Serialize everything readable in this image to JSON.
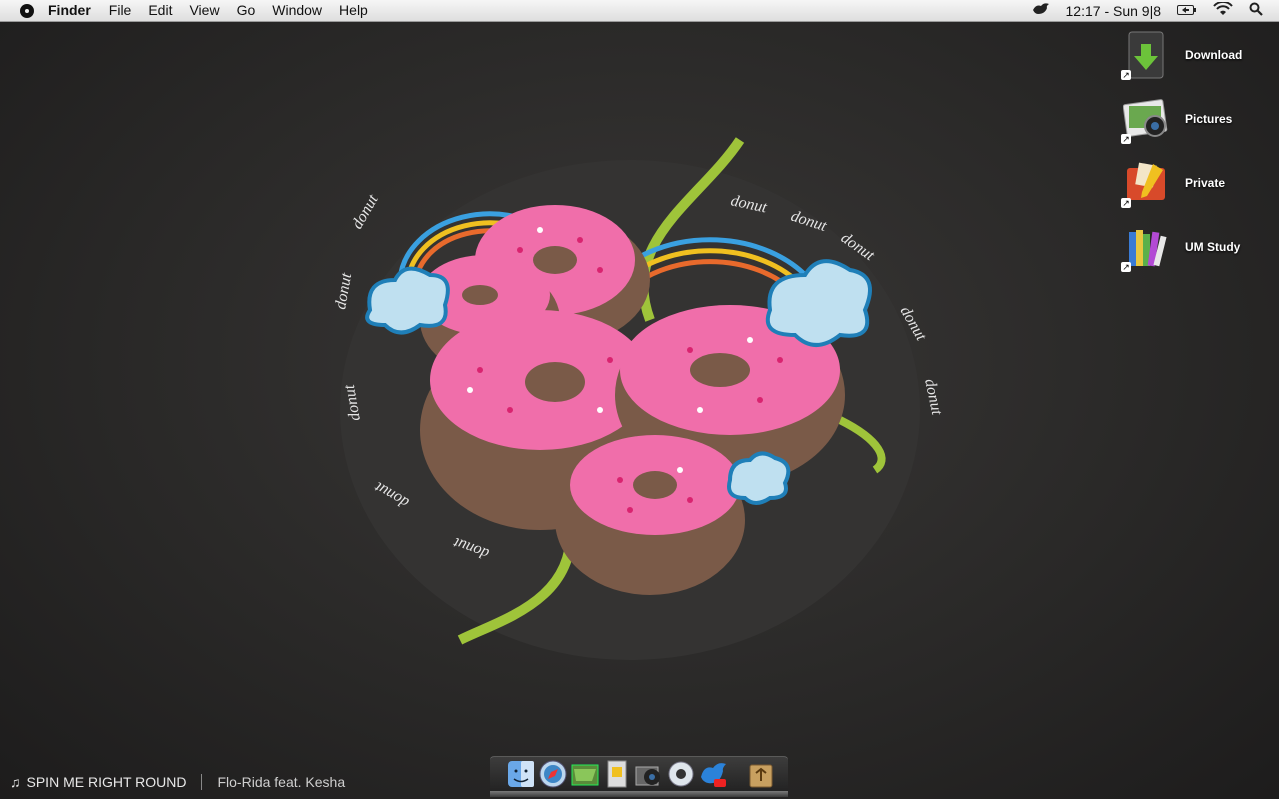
{
  "menubar": {
    "app_name": "Finder",
    "menus": [
      "File",
      "Edit",
      "View",
      "Go",
      "Window",
      "Help"
    ],
    "clock": "12:17 - Sun 9|8",
    "icons": [
      "bird-icon",
      "battery-icon",
      "wifi-icon",
      "spotlight-search-icon"
    ]
  },
  "desktop": {
    "items": [
      {
        "label": "Download",
        "icon": "download-folder-icon"
      },
      {
        "label": "Pictures",
        "icon": "pictures-folder-icon"
      },
      {
        "label": "Private",
        "icon": "private-folder-icon"
      },
      {
        "label": "UM Study",
        "icon": "books-folder-icon"
      }
    ]
  },
  "now_playing": {
    "title": "SPIN ME RIGHT ROUND",
    "artist": "Flo-Rida feat. Kesha"
  },
  "dock": {
    "apps": [
      "finder",
      "safari",
      "mail",
      "preview",
      "iphoto",
      "itunes",
      "twitter",
      "trash"
    ]
  },
  "wallpaper": {
    "text": "donut"
  }
}
